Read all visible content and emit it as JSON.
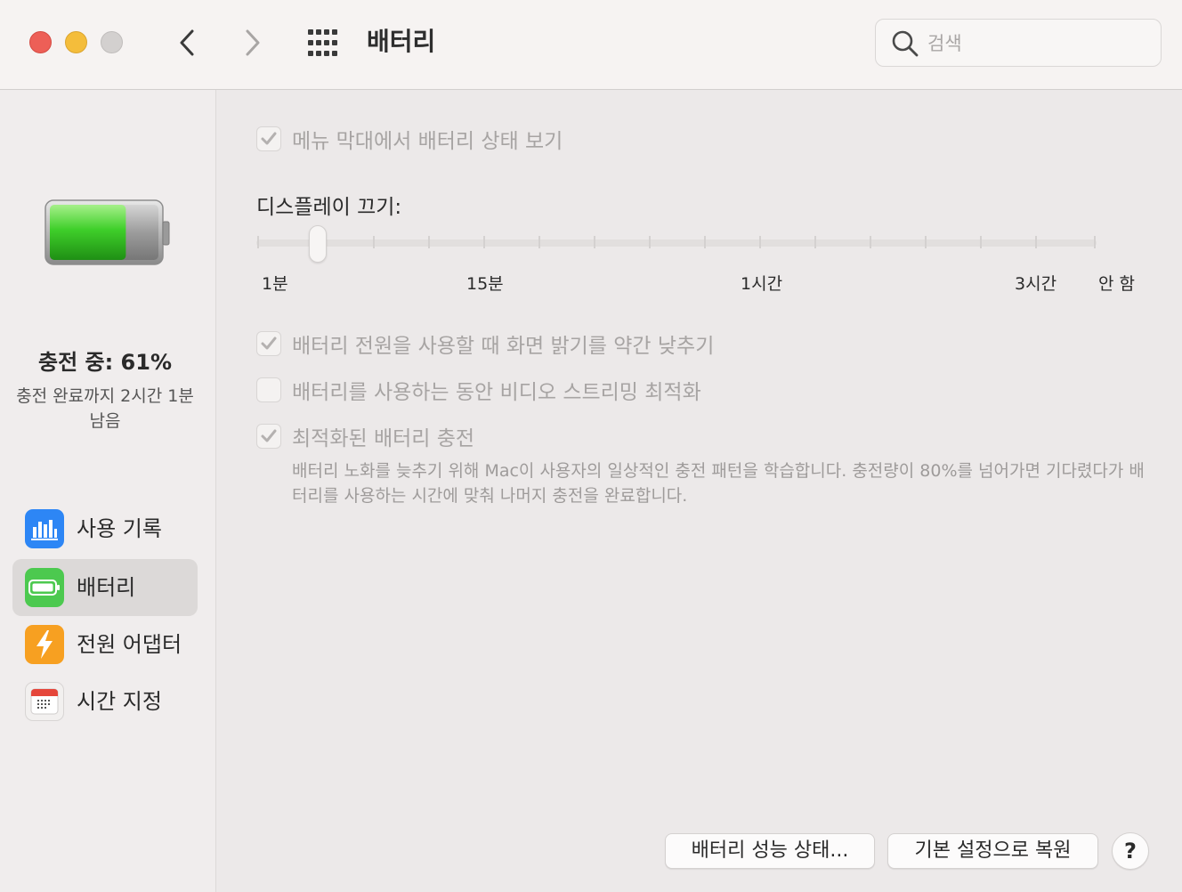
{
  "window": {
    "title": "배터리",
    "search": {
      "placeholder": "검색",
      "value": ""
    }
  },
  "sidebar": {
    "charge_status": "충전 중: 61%",
    "charge_time": "충전 완료까지 2시간 1분 남음",
    "battery_level_percent": 61,
    "items": [
      {
        "label": "사용 기록",
        "icon": "chart-bars-icon",
        "active": false
      },
      {
        "label": "배터리",
        "icon": "battery-icon",
        "active": true
      },
      {
        "label": "전원 어댑터",
        "icon": "lightning-bolt-icon",
        "active": false
      },
      {
        "label": "시간 지정",
        "icon": "calendar-icon",
        "active": false
      }
    ]
  },
  "main": {
    "menu_bar_option": {
      "label": "메뉴 막대에서 배터리 상태 보기",
      "checked": true
    },
    "display_off": {
      "title": "디스플레이 끄기:",
      "labels": [
        "1분",
        "15분",
        "1시간",
        "3시간",
        "안 함"
      ],
      "value": "2분"
    },
    "options": [
      {
        "label": "배터리 전원을 사용할 때 화면 밝기를 약간 낮추기",
        "checked": true
      },
      {
        "label": "배터리를 사용하는 동안 비디오 스트리밍 최적화",
        "checked": false
      },
      {
        "label": "최적화된 배터리 충전",
        "checked": true
      }
    ],
    "optimized_description": "배터리 노화를 늦추기 위해 Mac이 사용자의 일상적인 충전 패턴을 학습합니다. 충전량이 80%를 넘어가면 기다렸다가 배터리를 사용하는 시간에 맞춰 나머지 충전을 완료합니다.",
    "buttons": {
      "battery_health": "배터리 성능 상태...",
      "restore_defaults": "기본 설정으로 복원",
      "help": "?"
    }
  },
  "colors": {
    "close": "#ed5f57",
    "minimize": "#f4bd3b",
    "battery_green": "#3fcf2a",
    "usage_icon_blue": "#2d86f5",
    "battery_icon_green": "#4cc94f",
    "adapter_icon_orange": "#f7a021",
    "calendar_icon_red": "#e5463a"
  }
}
